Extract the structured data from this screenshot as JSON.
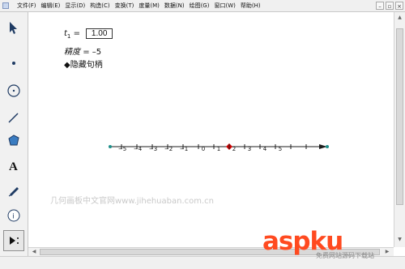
{
  "menu": {
    "items": [
      "文件(F)",
      "编辑(E)",
      "显示(D)",
      "构造(C)",
      "变换(T)",
      "度量(M)",
      "数据(N)",
      "绘图(G)",
      "窗口(W)",
      "帮助(H)"
    ]
  },
  "params": {
    "t1_label": "t",
    "t1_sub": "1",
    "equals": "=",
    "t1_value": "1.00",
    "precision_label": "精度",
    "precision_value": "= –5",
    "hide_handles": "◆隐藏句柄"
  },
  "numberline": {
    "ticks": [
      "−5",
      "−4",
      "−3",
      "−2",
      "−1",
      "0",
      "1",
      "2",
      "3",
      "4",
      "5"
    ]
  },
  "watermark": "几何画板中文官网www.jihehuaban.com.cn",
  "brand": {
    "text": "aspku",
    "subtitle": "免费网站源码下载站"
  },
  "colors": {
    "accent": "#ff4a20",
    "point_red": "#d10000",
    "point_teal": "#1e8f8a"
  }
}
